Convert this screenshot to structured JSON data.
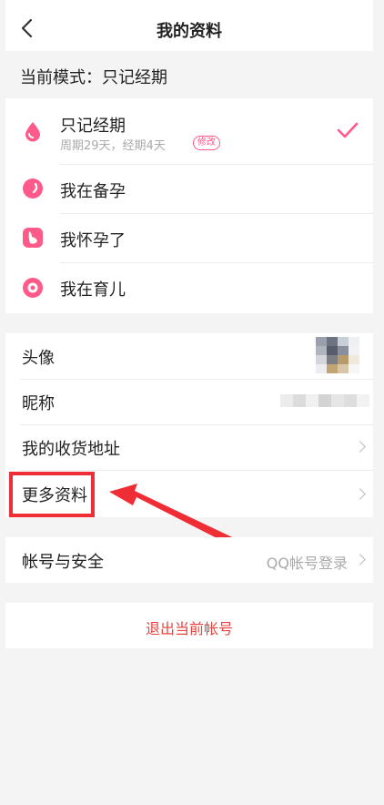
{
  "header": {
    "title": "我的资料"
  },
  "mode": {
    "label": "当前模式：只记经期"
  },
  "modes": [
    {
      "label": "只记经期",
      "sub": "周期29天，经期4天",
      "edit": "修改",
      "checked": true,
      "icon": "drop-icon"
    },
    {
      "label": "我在备孕",
      "icon": "egg-icon"
    },
    {
      "label": "我怀孕了",
      "icon": "pregnant-icon"
    },
    {
      "label": "我在育儿",
      "icon": "baby-icon"
    }
  ],
  "profile": {
    "avatar_label": "头像",
    "nickname_label": "昵称",
    "address_label": "我的收货地址",
    "more_label": "更多资料"
  },
  "account": {
    "label": "帐号与安全",
    "value": "QQ帐号登录"
  },
  "logout": {
    "label": "退出当前帐号"
  },
  "colors": {
    "accent": "#ff5a8a",
    "logout": "#e8433f",
    "annotation": "#ee2d35"
  }
}
